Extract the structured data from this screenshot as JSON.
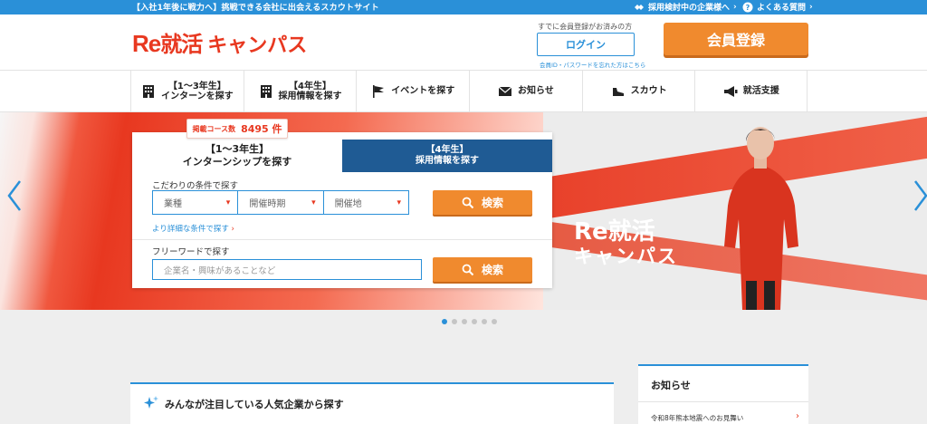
{
  "topbar": {
    "tagline": "【入社1年後に戦力へ】挑戦できる会社に出会えるスカウトサイト",
    "link_companies": "採用検討中の企業様へ",
    "link_faq": "よくある質問"
  },
  "header": {
    "logo_re": "Re",
    "logo_shu": "就活",
    "logo_camp": "キャンパス",
    "member_note": "すでに会員登録がお済みの方",
    "login_label": "ログイン",
    "forgot_label": "会員ID・パスワードを忘れた方はこちら",
    "register_label": "会員登録"
  },
  "nav": {
    "items": [
      {
        "line1": "【1〜3年生】",
        "line2": "インターンを探す",
        "icon": "building-icon"
      },
      {
        "line1": "【4年生】",
        "line2": "採用情報を探す",
        "icon": "building-icon"
      },
      {
        "line1": "イベントを探す",
        "line2": "",
        "icon": "flag-icon"
      },
      {
        "line1": "お知らせ",
        "line2": "",
        "icon": "mail-icon"
      },
      {
        "line1": "スカウト",
        "line2": "",
        "icon": "shoe-icon"
      },
      {
        "line1": "就活支援",
        "line2": "",
        "icon": "megaphone-icon"
      }
    ]
  },
  "hero": {
    "logo_line1": "Re就活",
    "logo_line2": "キャンパス"
  },
  "search": {
    "count_label": "掲載コース数",
    "count_value": "8495 件",
    "tab1_line1": "【1〜3年生】",
    "tab1_line2": "インターンシップを探す",
    "tab2_line1": "【4年生】",
    "tab2_line2": "採用情報を探す",
    "conditions_label": "こだわりの条件で探す",
    "select_industry": "業種",
    "select_period": "開催時期",
    "select_location": "開催地",
    "search_label": "検索",
    "detail_link": "より詳細な条件で探す",
    "freeword_label": "フリーワードで探す",
    "keyword_placeholder": "企業名・興味があることなど"
  },
  "carousel": {
    "slides": 6,
    "active": 0
  },
  "popular": {
    "title": "みんなが注目している人気企業から探す"
  },
  "news": {
    "title": "お知らせ",
    "item1": "令和8年熊本地震へのお見舞い"
  },
  "colors": {
    "brand_red": "#e83820",
    "accent_blue": "#2a90d8",
    "cta_orange": "#f08a2e",
    "tab_navy": "#1f5b94"
  }
}
